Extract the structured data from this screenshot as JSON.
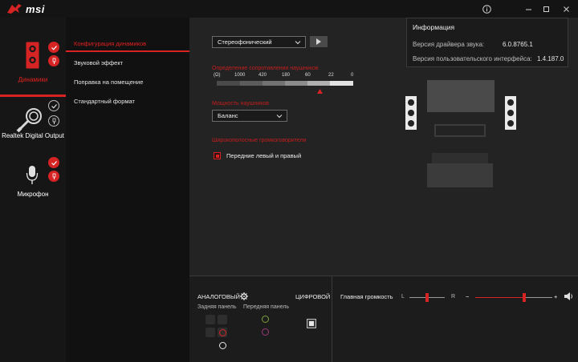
{
  "window": {
    "brand": "msi",
    "info_icon": "info-circle-icon",
    "minimize_icon": "minimize-icon",
    "maximize_icon": "maximize-icon",
    "close_icon": "close-icon"
  },
  "devices": [
    {
      "label": "Динамики",
      "active": true,
      "icon": "speaker-icon",
      "status": [
        "check-icon",
        "plug-icon"
      ]
    },
    {
      "label": "Realtek Digital Output",
      "active": false,
      "icon": "optical-cable-icon",
      "status": [
        "check-icon",
        "plug-icon"
      ]
    },
    {
      "label": "Микрофон",
      "active": false,
      "icon": "microphone-icon",
      "status": [
        "check-icon",
        "plug-icon"
      ]
    }
  ],
  "tabs": [
    {
      "label": "Конфигурация динамиков",
      "active": true
    },
    {
      "label": "Звуковой эффект",
      "active": false
    },
    {
      "label": "Поправка на помещение",
      "active": false
    },
    {
      "label": "Стандартный формат",
      "active": false
    }
  ],
  "config": {
    "mode_value": "Стереофонический",
    "impedance_title": "Определение сопротивления наушников",
    "impedance_ticks": [
      "(Ω)",
      "1000",
      "420",
      "180",
      "60",
      "22",
      "0"
    ],
    "power_title": "Мощность наушников",
    "power_value": "Баланс",
    "fullrange_title": "Широкополосные громкоговорители",
    "fullrange_option": "Передние левый и правый",
    "fullrange_checked": true
  },
  "info": {
    "title": "Информация",
    "driver_label": "Версия драйвера звука:",
    "driver_value": "6.0.8765.1",
    "ui_label": "Версия пользовательского интерфейса:",
    "ui_value": "1.4.187.0"
  },
  "bottom": {
    "analog_label": "АНАЛОГОВЫЙ",
    "digital_label": "ЦИФРОВОЙ",
    "rear_panel_label": "Задняя панель",
    "front_panel_label": "Передняя панель",
    "main_volume_label": "Главная громкость",
    "balance_left": "L",
    "balance_right": "R",
    "volume_minus": "−",
    "volume_plus": "+",
    "balance_value": 0.5,
    "volume_value": 0.64
  },
  "colors": {
    "accent": "#d62323",
    "background": "#232323"
  }
}
